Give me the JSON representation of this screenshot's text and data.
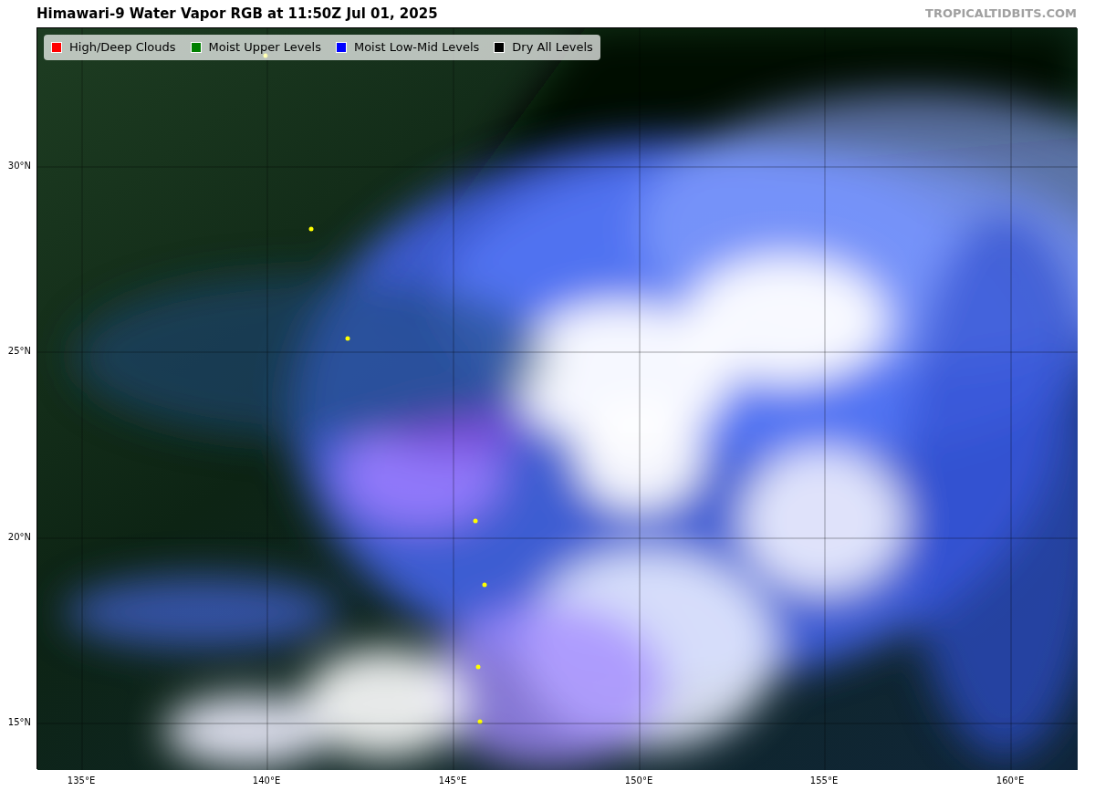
{
  "title": "Himawari-9 Water Vapor RGB at 11:50Z Jul 01, 2025",
  "credit": "TROPICALTIDBITS.COM",
  "legend": [
    {
      "label": "High/Deep Clouds",
      "color": "#ff0000"
    },
    {
      "label": "Moist Upper Levels",
      "color": "#008000"
    },
    {
      "label": "Moist Low-Mid Levels",
      "color": "#0000ff"
    },
    {
      "label": "Dry All Levels",
      "color": "#000000"
    }
  ],
  "map": {
    "latitude_labels": [
      "30°N",
      "25°N",
      "20°N",
      "15°N"
    ],
    "longitude_labels": [
      "135°E",
      "140°E",
      "145°E",
      "150°E",
      "155°E",
      "160°E"
    ]
  }
}
